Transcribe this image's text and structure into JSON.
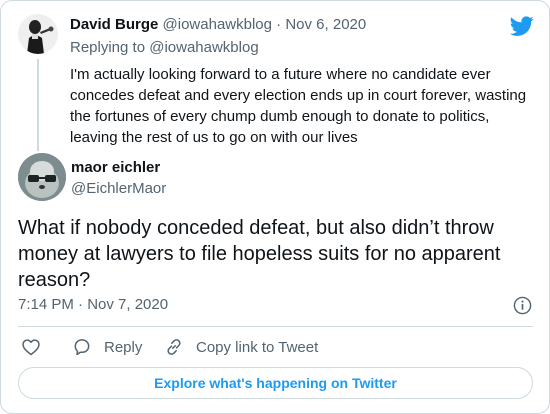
{
  "parent_tweet": {
    "author_name": "David Burge",
    "author_handle": "@iowahawkblog",
    "separator": "·",
    "date": "Nov 6, 2020",
    "replying_to": "Replying to @iowahawkblog",
    "text": "I'm actually looking forward to a future where no candidate ever concedes defeat and every election ends up in court forever, wasting the fortunes of every chump dumb enough to donate to politics, leaving the rest of us to go on with our lives"
  },
  "main_tweet": {
    "author_name": "maor eichler",
    "author_handle": "@EichlerMaor",
    "text": "What if nobody conceded defeat, but also didn’t throw money at lawyers to file hopeless suits for no apparent reason?",
    "timestamp": "7:14 PM · Nov 7, 2020"
  },
  "actions": {
    "reply_label": "Reply",
    "copy_link_label": "Copy link to Tweet"
  },
  "explore_label": "Explore what's happening on Twitter",
  "colors": {
    "brand_blue": "#1d9bf0",
    "text_primary": "#0f1419",
    "text_secondary": "#536471",
    "border": "#cfd9de"
  },
  "icons": [
    "twitter-bird-icon",
    "info-icon",
    "heart-icon",
    "reply-bubble-icon",
    "link-icon"
  ]
}
